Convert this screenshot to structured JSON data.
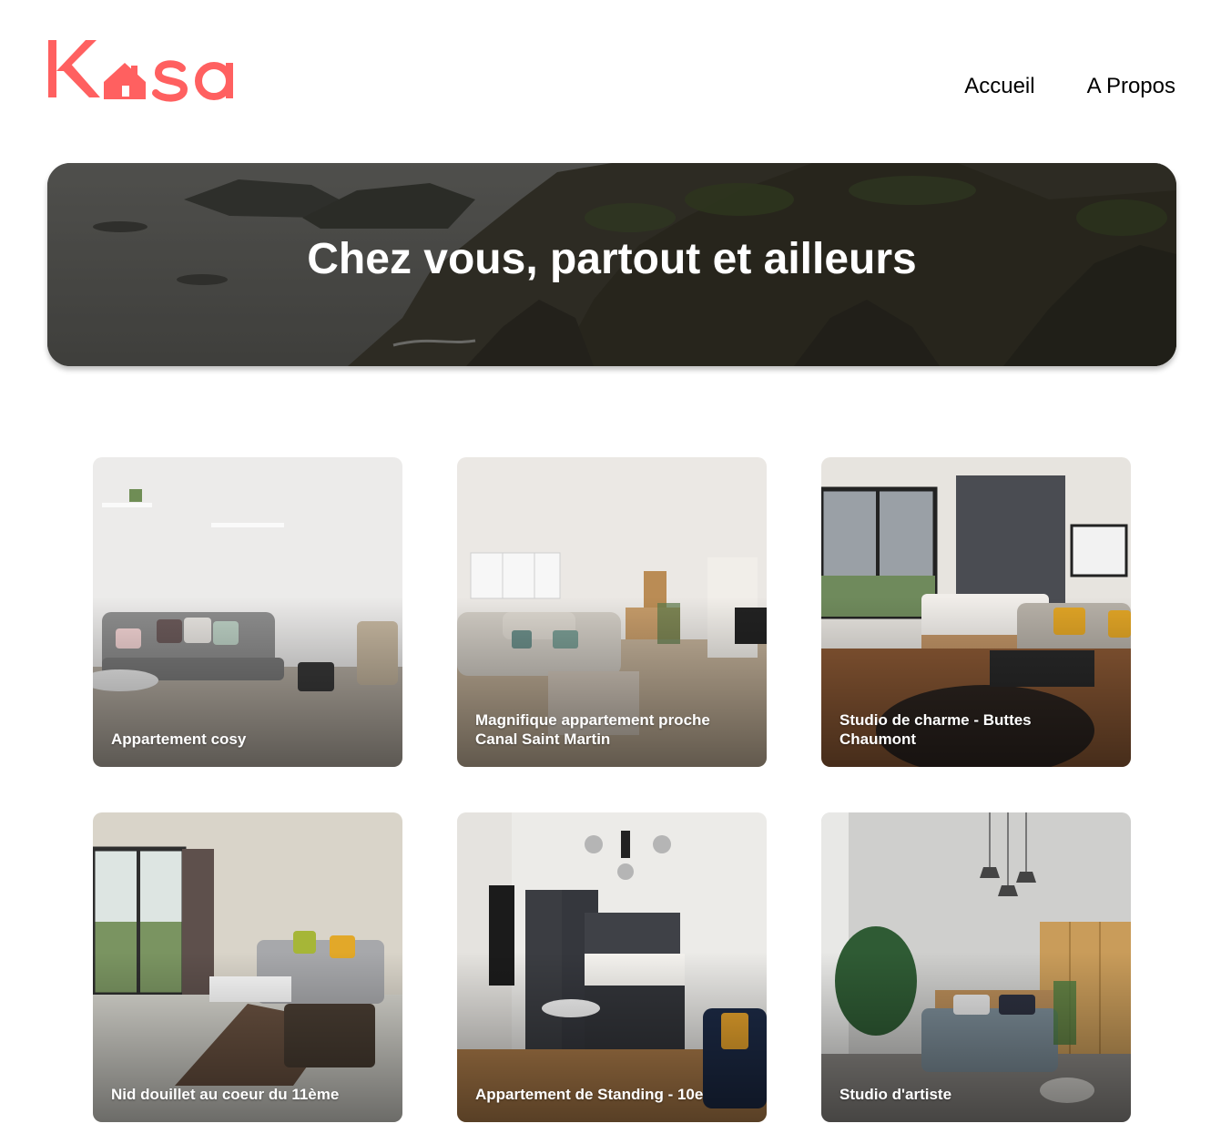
{
  "brand": {
    "logo_text": "Kasa",
    "accent_color": "#FF6060"
  },
  "nav": {
    "items": [
      {
        "label": "Accueil"
      },
      {
        "label": "A Propos"
      }
    ]
  },
  "banner": {
    "title": "Chez vous, partout et ailleurs"
  },
  "listings": [
    {
      "title": "Appartement cosy"
    },
    {
      "title": "Magnifique appartement proche Canal Saint Martin"
    },
    {
      "title": "Studio de charme - Buttes Chaumont"
    },
    {
      "title": "Nid douillet au coeur du 11ème"
    },
    {
      "title": "Appartement de Standing - 10e"
    },
    {
      "title": "Studio d'artiste"
    }
  ]
}
